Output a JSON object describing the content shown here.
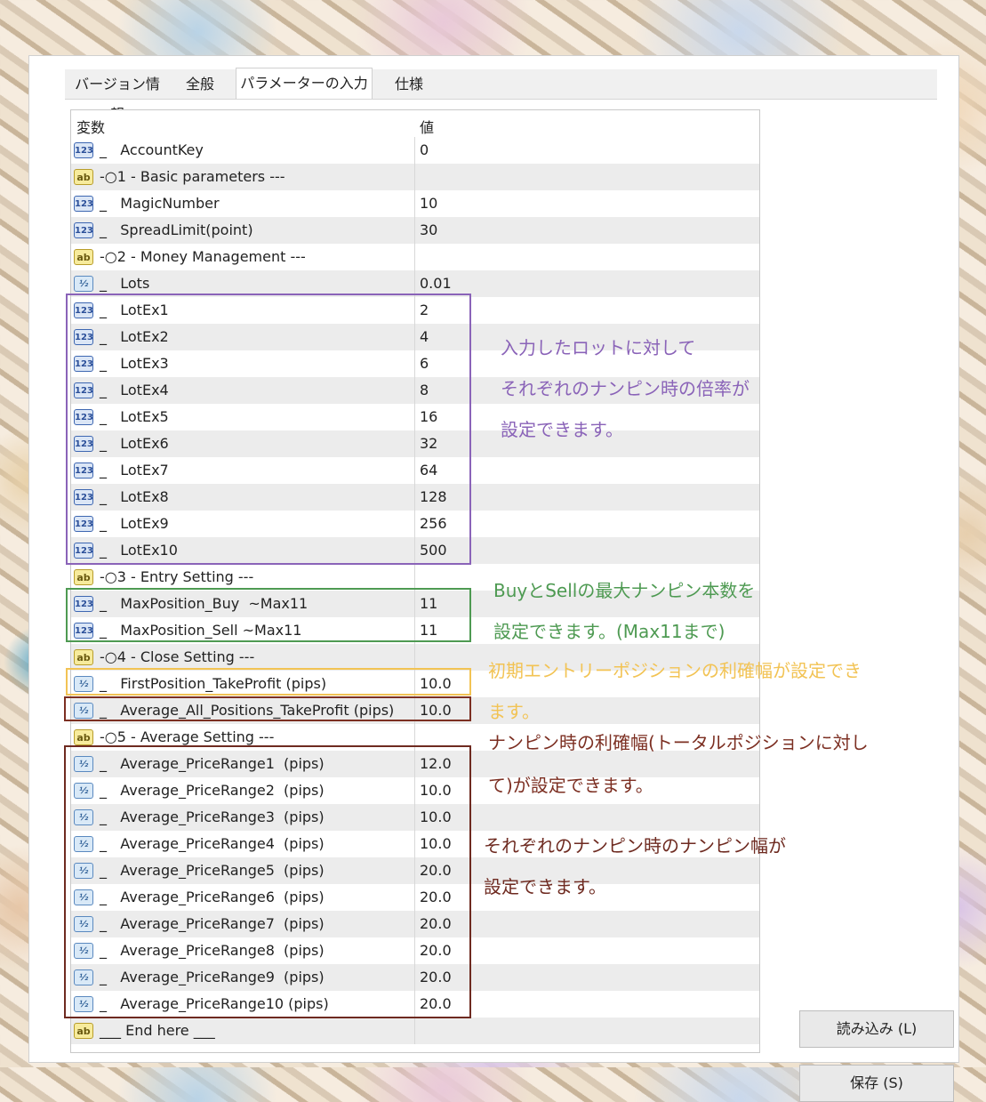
{
  "tabs": [
    {
      "label": "バージョン情報"
    },
    {
      "label": "全般"
    },
    {
      "label": "パラメーターの入力"
    },
    {
      "label": "仕様"
    }
  ],
  "grid": {
    "header_variable": "変数",
    "header_value": "値",
    "rows": [
      {
        "type": "int",
        "icon_text": "123",
        "name": "_   AccountKey",
        "value": "0"
      },
      {
        "type": "str",
        "icon_text": "ab",
        "name": "-○1 - Basic parameters ---",
        "value": ""
      },
      {
        "type": "int",
        "icon_text": "123",
        "name": "_   MagicNumber",
        "value": "10"
      },
      {
        "type": "int",
        "icon_text": "123",
        "name": "_   SpreadLimit(point)",
        "value": "30"
      },
      {
        "type": "str",
        "icon_text": "ab",
        "name": "-○2 - Money Management ---",
        "value": ""
      },
      {
        "type": "dbl",
        "icon_text": "½",
        "name": "_   Lots",
        "value": "0.01"
      },
      {
        "type": "int",
        "icon_text": "123",
        "name": "_   LotEx1",
        "value": "2"
      },
      {
        "type": "int",
        "icon_text": "123",
        "name": "_   LotEx2",
        "value": "4"
      },
      {
        "type": "int",
        "icon_text": "123",
        "name": "_   LotEx3",
        "value": "6"
      },
      {
        "type": "int",
        "icon_text": "123",
        "name": "_   LotEx4",
        "value": "8"
      },
      {
        "type": "int",
        "icon_text": "123",
        "name": "_   LotEx5",
        "value": "16"
      },
      {
        "type": "int",
        "icon_text": "123",
        "name": "_   LotEx6",
        "value": "32"
      },
      {
        "type": "int",
        "icon_text": "123",
        "name": "_   LotEx7",
        "value": "64"
      },
      {
        "type": "int",
        "icon_text": "123",
        "name": "_   LotEx8",
        "value": "128"
      },
      {
        "type": "int",
        "icon_text": "123",
        "name": "_   LotEx9",
        "value": "256"
      },
      {
        "type": "int",
        "icon_text": "123",
        "name": "_   LotEx10",
        "value": "500"
      },
      {
        "type": "str",
        "icon_text": "ab",
        "name": "-○3 - Entry Setting ---",
        "value": ""
      },
      {
        "type": "int",
        "icon_text": "123",
        "name": "_   MaxPosition_Buy  ~Max11",
        "value": "11"
      },
      {
        "type": "int",
        "icon_text": "123",
        "name": "_   MaxPosition_Sell ~Max11",
        "value": "11"
      },
      {
        "type": "str",
        "icon_text": "ab",
        "name": "-○4 - Close Setting ---",
        "value": ""
      },
      {
        "type": "dbl",
        "icon_text": "½",
        "name": "_   FirstPosition_TakeProfit (pips)",
        "value": "10.0"
      },
      {
        "type": "dbl",
        "icon_text": "½",
        "name": "_   Average_All_Positions_TakeProfit (pips)",
        "value": "10.0"
      },
      {
        "type": "str",
        "icon_text": "ab",
        "name": "-○5 - Average Setting ---",
        "value": ""
      },
      {
        "type": "dbl",
        "icon_text": "½",
        "name": "_   Average_PriceRange1  (pips)",
        "value": "12.0"
      },
      {
        "type": "dbl",
        "icon_text": "½",
        "name": "_   Average_PriceRange2  (pips)",
        "value": "10.0"
      },
      {
        "type": "dbl",
        "icon_text": "½",
        "name": "_   Average_PriceRange3  (pips)",
        "value": "10.0"
      },
      {
        "type": "dbl",
        "icon_text": "½",
        "name": "_   Average_PriceRange4  (pips)",
        "value": "10.0"
      },
      {
        "type": "dbl",
        "icon_text": "½",
        "name": "_   Average_PriceRange5  (pips)",
        "value": "20.0"
      },
      {
        "type": "dbl",
        "icon_text": "½",
        "name": "_   Average_PriceRange6  (pips)",
        "value": "20.0"
      },
      {
        "type": "dbl",
        "icon_text": "½",
        "name": "_   Average_PriceRange7  (pips)",
        "value": "20.0"
      },
      {
        "type": "dbl",
        "icon_text": "½",
        "name": "_   Average_PriceRange8  (pips)",
        "value": "20.0"
      },
      {
        "type": "dbl",
        "icon_text": "½",
        "name": "_   Average_PriceRange9  (pips)",
        "value": "20.0"
      },
      {
        "type": "dbl",
        "icon_text": "½",
        "name": "_   Average_PriceRange10 (pips)",
        "value": "20.0"
      },
      {
        "type": "str",
        "icon_text": "ab",
        "name": "___ End here ___",
        "value": ""
      }
    ]
  },
  "annotations": {
    "lot_multiplier": [
      "入力したロットに対して",
      "それぞれのナンピン時の倍率が",
      "設定できます。"
    ],
    "max_positions": [
      "BuyとSellの最大ナンピン本数を",
      "設定できます。(Max11まで)"
    ],
    "first_take_profit": [
      "初期エントリーポジションの利確幅が設定でき",
      "ます。"
    ],
    "average_take_profit": [
      "ナンピン時の利確幅(トータルポジションに対し",
      "て)が設定できます。"
    ],
    "price_range": [
      "それぞれのナンピン時のナンピン幅が",
      "設定できます。"
    ]
  },
  "buttons": {
    "load": "読み込み (L)",
    "save": "保存 (S)"
  },
  "colors": {
    "purple": "#8a63b8",
    "green": "#4e9a52",
    "yellow": "#f2c354",
    "brown": "#7c2f22"
  }
}
